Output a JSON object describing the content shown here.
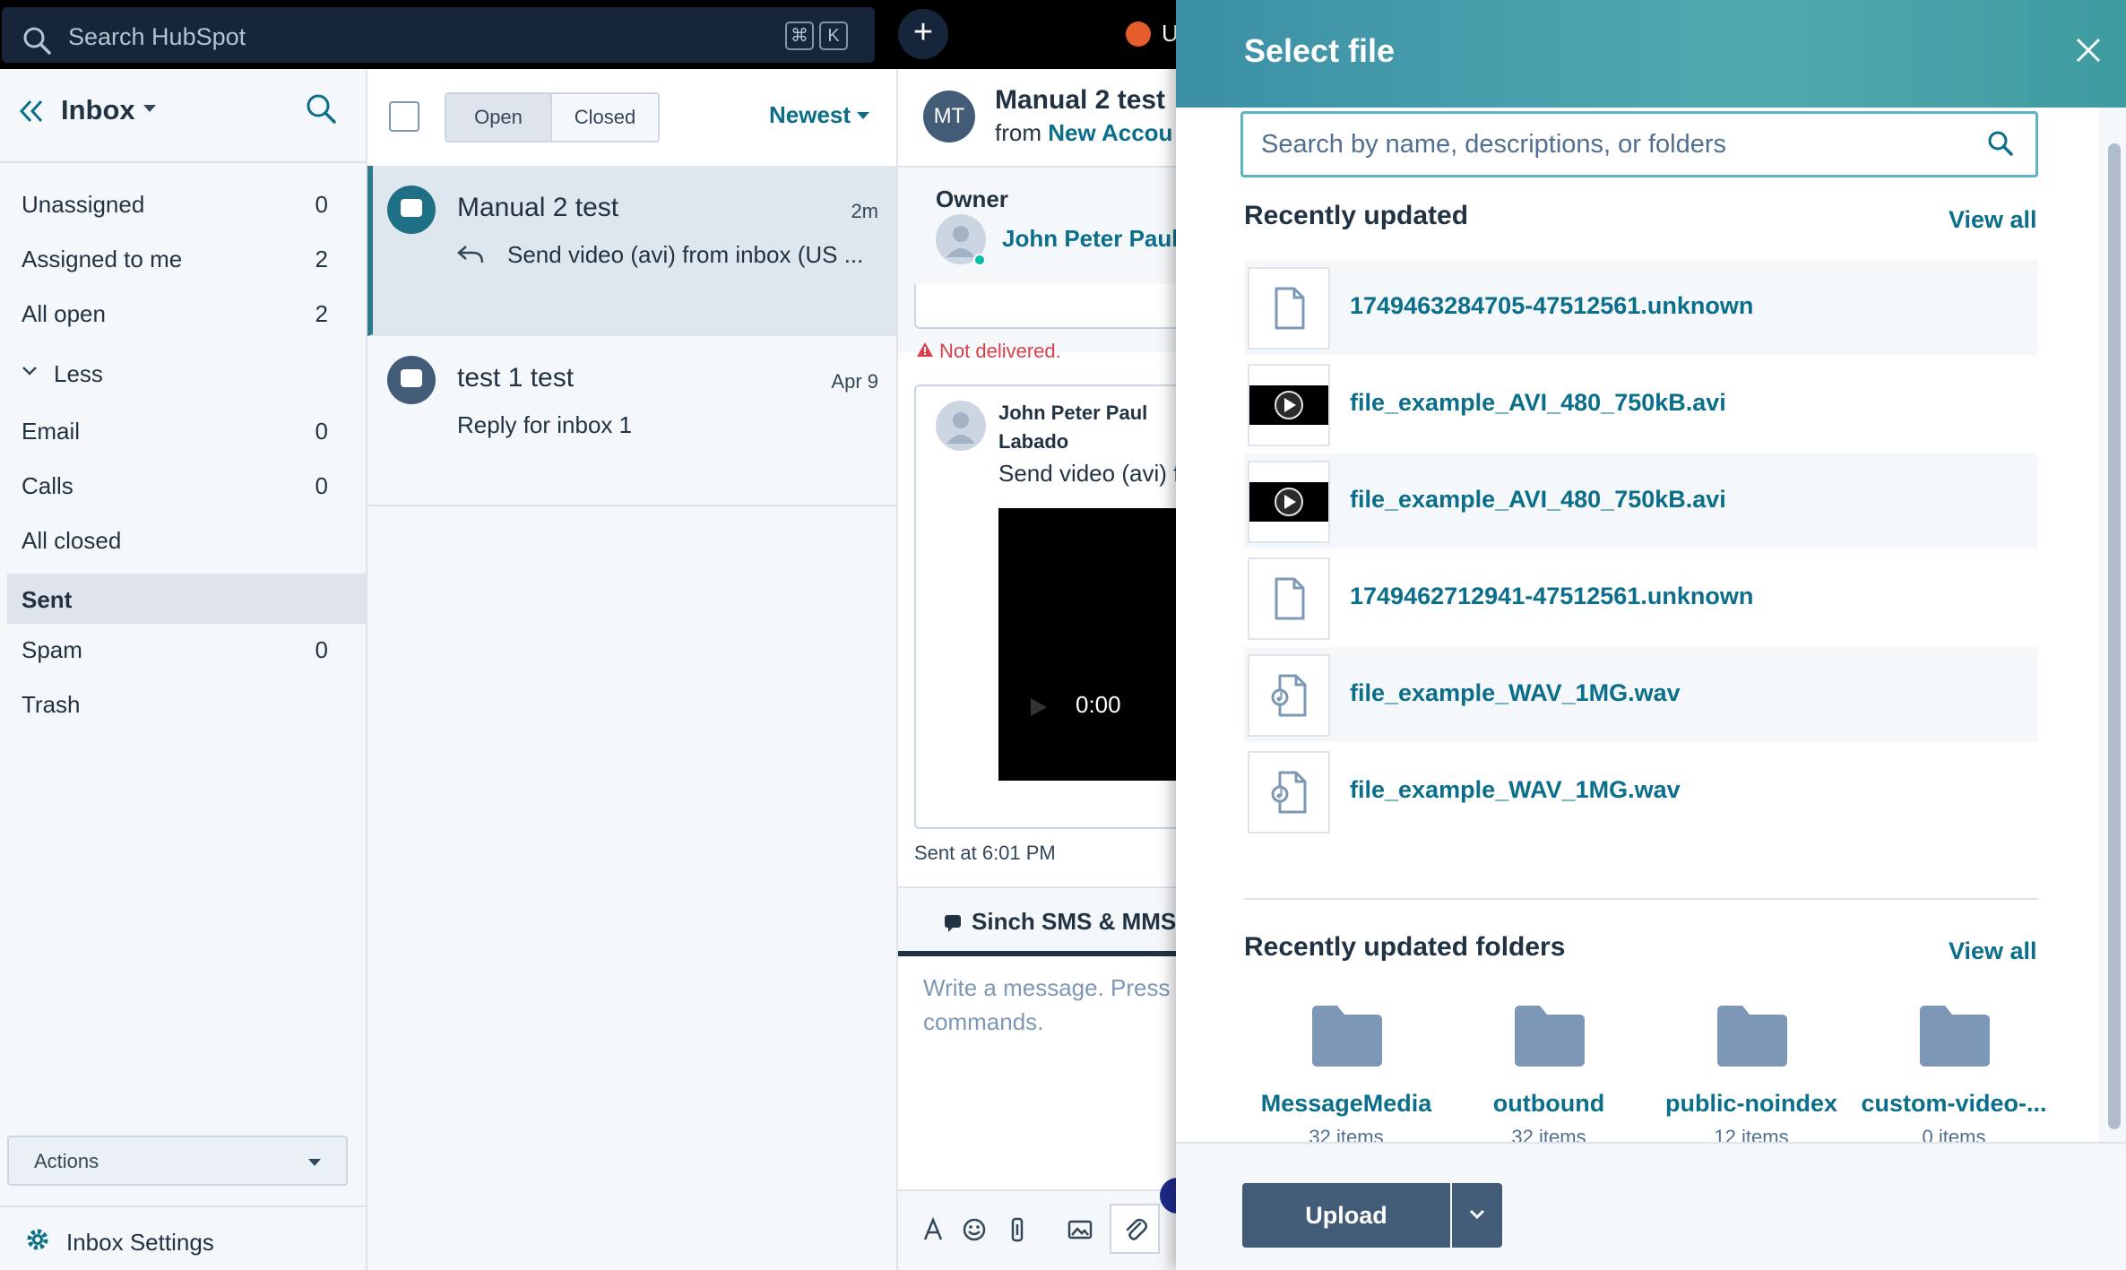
{
  "topnav": {
    "search_placeholder": "Search HubSpot",
    "shortcut_keys": [
      "⌘",
      "K"
    ],
    "plus_label": "+",
    "upgrade_label": "U"
  },
  "sidebar": {
    "title": "Inbox",
    "items": [
      {
        "label": "Unassigned",
        "count": "0"
      },
      {
        "label": "Assigned to me",
        "count": "2"
      },
      {
        "label": "All open",
        "count": "2"
      },
      {
        "label": "Less",
        "count": ""
      },
      {
        "label": "Email",
        "count": "0"
      },
      {
        "label": "Calls",
        "count": "0"
      },
      {
        "label": "All closed",
        "count": ""
      },
      {
        "label": "Sent",
        "count": ""
      },
      {
        "label": "Spam",
        "count": "0"
      },
      {
        "label": "Trash",
        "count": ""
      }
    ],
    "actions_label": "Actions",
    "settings_label": "Inbox Settings"
  },
  "threadlist": {
    "tabs": [
      "Open",
      "Closed"
    ],
    "sort_label": "Newest",
    "threads": [
      {
        "name": "Manual 2 test",
        "time": "2m",
        "preview": "Send video (avi) from inbox (US ..."
      },
      {
        "name": "test 1 test",
        "time": "Apr 9",
        "preview": "Reply for inbox 1"
      }
    ]
  },
  "conversation": {
    "avatar_initials": "MT",
    "name": "Manual 2 test",
    "from_prefix": "from",
    "from_source": "New Accou",
    "owner_label": "Owner",
    "owner_name": "John Peter Paul",
    "not_delivered": "Not delivered.",
    "sender_line1": "John Peter Paul",
    "sender_line2": "Labado",
    "message_text": "Send video (avi) f",
    "video_time": "0:00",
    "sent_at": "Sent at 6:01 PM",
    "channel": "Sinch SMS & MMS",
    "compose_placeholder_1": "Write a message. Press '",
    "compose_placeholder_2": "commands."
  },
  "modal": {
    "title": "Select file",
    "search_placeholder": "Search by name, descriptions, or folders",
    "recent_title": "Recently updated",
    "view_all": "View all",
    "files": [
      {
        "name": "1749463284705-47512561.unknown",
        "kind": "doc"
      },
      {
        "name": "file_example_AVI_480_750kB.avi",
        "kind": "video"
      },
      {
        "name": "file_example_AVI_480_750kB.avi",
        "kind": "video"
      },
      {
        "name": "1749462712941-47512561.unknown",
        "kind": "doc"
      },
      {
        "name": "file_example_WAV_1MG.wav",
        "kind": "audio"
      },
      {
        "name": "file_example_WAV_1MG.wav",
        "kind": "audio"
      }
    ],
    "folders_title": "Recently updated folders",
    "folders": [
      {
        "name": "MessageMedia",
        "count": "32 items"
      },
      {
        "name": "outbound",
        "count": "32 items"
      },
      {
        "name": "public-noindex",
        "count": "12 items"
      },
      {
        "name": "custom-video-...",
        "count": "0 items"
      }
    ],
    "upload_label": "Upload"
  },
  "colors": {
    "accent": "#0b6e8a",
    "header_teal": "#4faaaf",
    "dark_button": "#425b76",
    "error": "#d93f4c"
  }
}
